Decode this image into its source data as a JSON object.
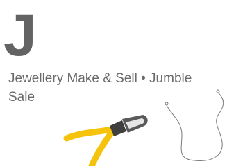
{
  "letter": "J",
  "topics": "Jewellery Make & Sell • Jumble Sale",
  "icons": {
    "pliers": "pliers-icon",
    "wire": "necklace-wire-icon"
  },
  "colors": {
    "letter": "#636363",
    "text": "#6a6a6a",
    "pliers_handle": "#f5c20c",
    "pliers_head": "#4a4a4a",
    "wire": "#7a7a7a"
  }
}
